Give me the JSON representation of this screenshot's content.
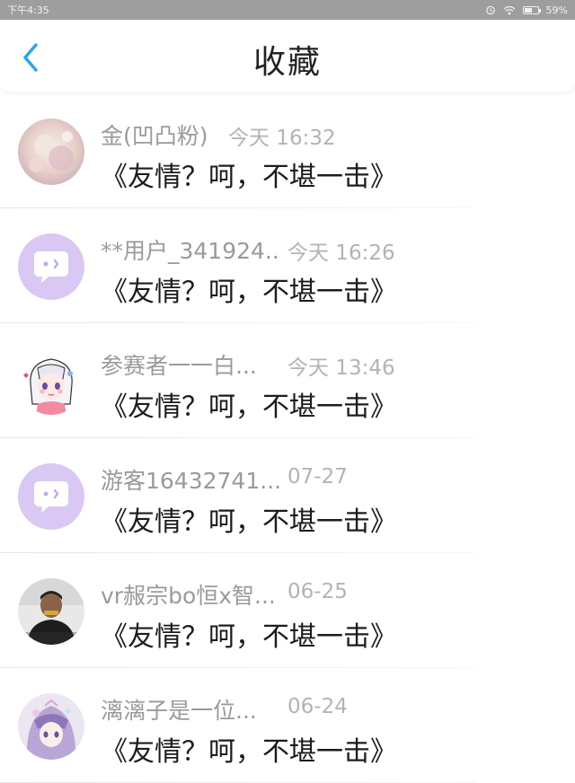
{
  "status_bar": {
    "time": "下午4:35",
    "battery": "59%",
    "battery_level": 0.59
  },
  "header": {
    "title": "收藏",
    "back_icon": "chevron-left-icon",
    "accent": "#2aa4f4"
  },
  "items": [
    {
      "name": "金(凹凸粉)",
      "time": "今天 16:32",
      "content": "《友情？呵，不堪一击》",
      "avatar": "photo-pink"
    },
    {
      "name": "**用户_341924..",
      "time": "今天 16:26",
      "content": "《友情？呵，不堪一击》",
      "avatar": "chat-bubble-default"
    },
    {
      "name": "参赛者一一白...",
      "time": "今天 13:46",
      "content": "《友情？呵，不堪一击》",
      "avatar": "anime-girl"
    },
    {
      "name": "游客16432741...",
      "time": "07-27",
      "content": "《友情？呵，不堪一击》",
      "avatar": "chat-bubble-default"
    },
    {
      "name": "vr赧宗bo恒x智...",
      "time": "06-25",
      "content": "《友情？呵，不堪一击》",
      "avatar": "photo-person"
    },
    {
      "name": "漓漓子是一位...",
      "time": "06-24",
      "content": "《友情？呵，不堪一击》",
      "avatar": "anime-purple"
    }
  ]
}
